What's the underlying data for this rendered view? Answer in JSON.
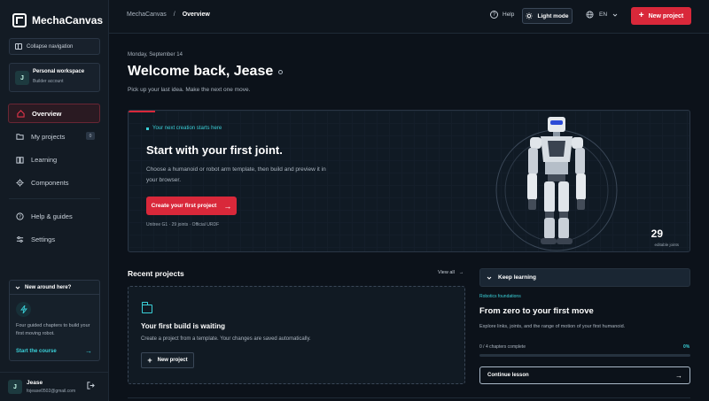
{
  "app": {
    "name": "MechaCanvas"
  },
  "sidebar": {
    "collapse_label": "Collapse navigation",
    "workspace": {
      "avatar": "J",
      "name": "Personal workspace",
      "subtitle": "Builder account"
    },
    "items": [
      {
        "label": "Overview",
        "icon": "home-icon",
        "active": true
      },
      {
        "label": "My projects",
        "icon": "folder-icon",
        "badge": "0"
      },
      {
        "label": "Learning",
        "icon": "book-icon"
      },
      {
        "label": "Components",
        "icon": "gear-icon"
      },
      {
        "label": "Help & guides",
        "icon": "help-icon"
      },
      {
        "label": "Settings",
        "icon": "sliders-icon"
      }
    ],
    "new_around": {
      "title": "New around here?",
      "text": "Four guided chapters to build your first moving robot.",
      "link": "Start the course"
    },
    "user": {
      "avatar": "J",
      "name": "Jease",
      "email": "fojease0502@gmail.com"
    }
  },
  "topbar": {
    "breadcrumb": [
      "MechaCanvas",
      "/",
      "Overview"
    ],
    "help": "Help",
    "light_mode": "Light mode",
    "language": "EN",
    "new_project": "New project"
  },
  "main": {
    "date": "Monday, September 14",
    "welcome": "Welcome back, Jease",
    "subtitle": "Pick up your last idea. Make the next one move.",
    "hero": {
      "eyebrow": "Your next creation starts here",
      "title": "Start with your first joint.",
      "description": "Choose a humanoid or robot arm template, then build and preview it in your browser.",
      "cta": "Create your first project",
      "footnote": "Unitree G1 · 29 joints · Official URDF",
      "joints_count": "29",
      "joints_label": "editable joints"
    },
    "recent": {
      "title": "Recent projects",
      "view_all": "View all",
      "empty_title": "Your first build is waiting",
      "empty_desc": "Create a project from a template. Your changes are saved automatically.",
      "button": "New project"
    },
    "learning": {
      "header": "Keep learning",
      "eyebrow": "Robotics foundations",
      "title": "From zero to your first move",
      "description": "Explore links, joints, and the range of motion of your first humanoid.",
      "progress_text": "0 / 4 chapters complete",
      "progress_pct": "0%",
      "progress_value": 0,
      "button": "Continue lesson"
    }
  },
  "colors": {
    "accent": "#d9283a",
    "teal": "#3ad0d8",
    "bg": "#0c121a"
  }
}
